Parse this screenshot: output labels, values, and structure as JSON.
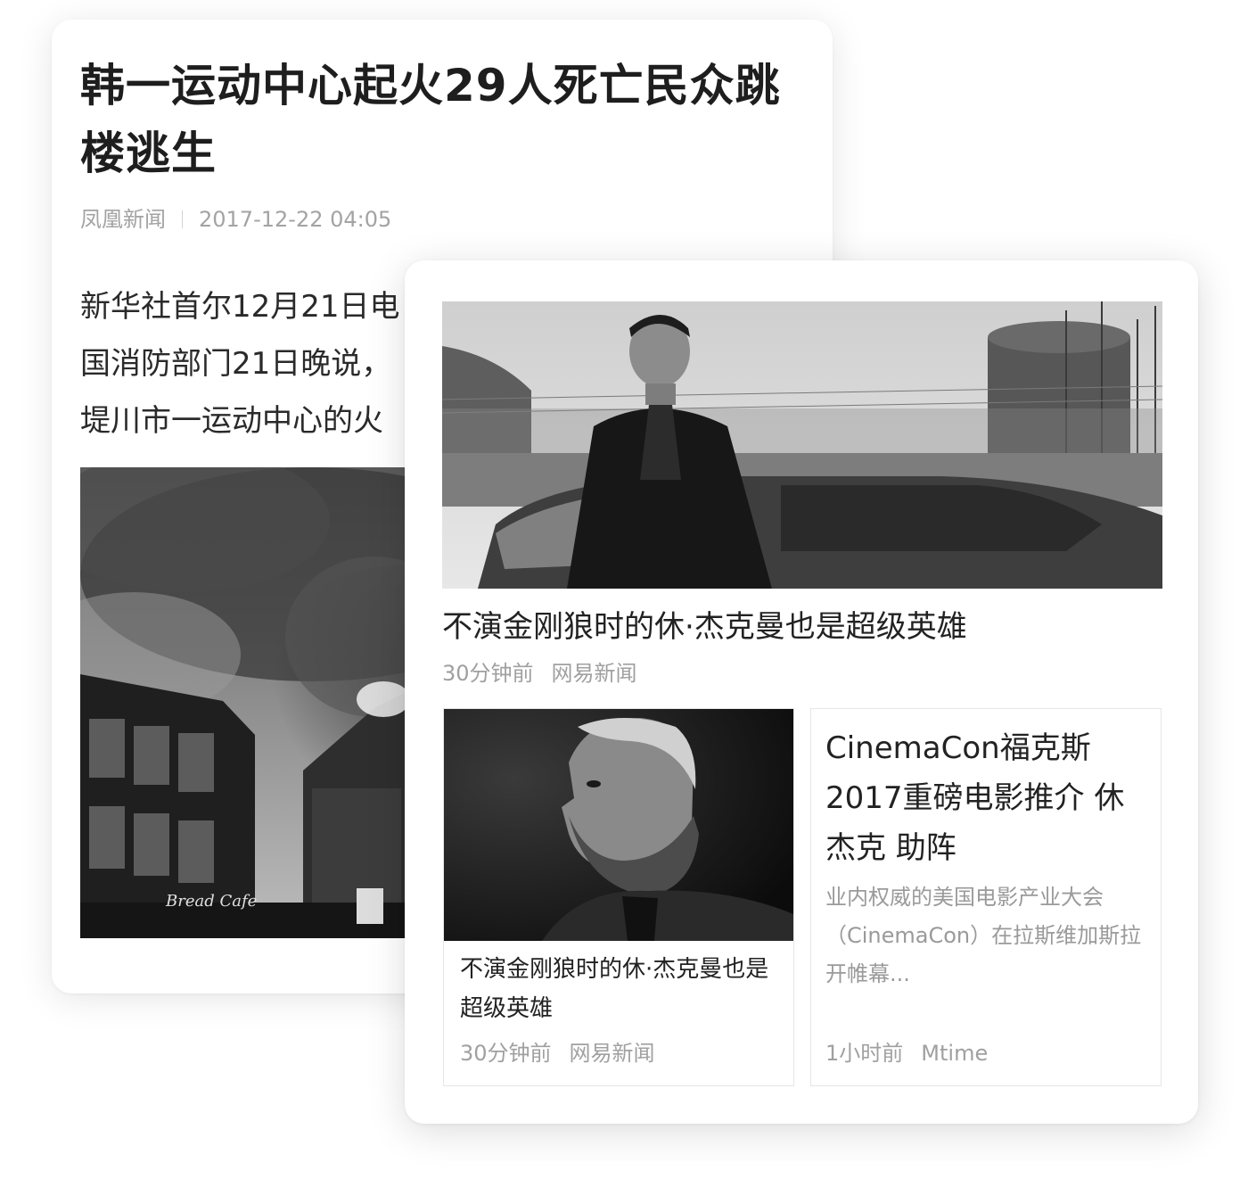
{
  "article": {
    "title": "韩一运动中心起火29人死亡民众跳楼逃生",
    "source": "凤凰新闻",
    "time": "2017-12-22 04:05",
    "body": "新华社首尔12月21日电\n国消防部门21日晚说，\n堤川市一运动中心的火",
    "photo_icon": "building-fire-photo",
    "photo_caption_text": "Bread Cafe"
  },
  "feed": {
    "hero": {
      "title": "不演金刚狼时的休·杰克曼也是超级英雄",
      "time": "30分钟前",
      "source": "网易新闻",
      "photo_icon": "man-with-car-photo"
    },
    "tiles": [
      {
        "title": "不演金刚狼时的休·杰克曼也是超级英雄",
        "time": "30分钟前",
        "source": "网易新闻",
        "photo_icon": "bearded-man-portrait-photo"
      },
      {
        "title": "CinemaCon福克斯2017重磅电影推介 休杰克 助阵",
        "description": "业内权威的美国电影产业大会（CinemaCon）在拉斯维加斯拉开帷幕...",
        "time": "1小时前",
        "source": "Mtime"
      }
    ]
  },
  "colors": {
    "title": "#1e1e1e",
    "meta": "#a3a3a3",
    "border": "#e6e6e6",
    "background": "#ffffff"
  }
}
